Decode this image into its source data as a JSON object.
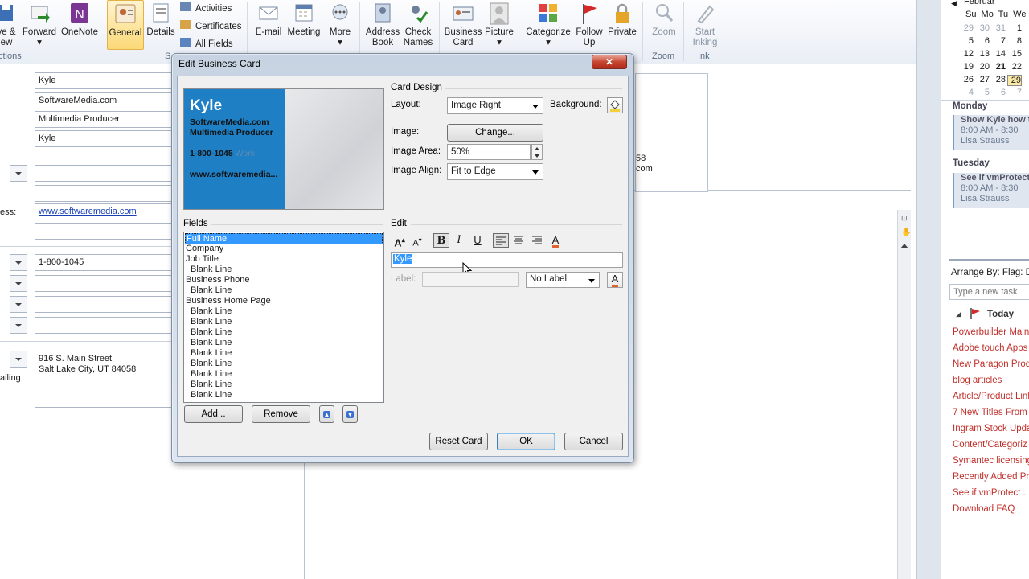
{
  "ribbon": {
    "buttons": [
      {
        "label": "ve &\new",
        "icon": "save-new-icon"
      },
      {
        "label": "Forward",
        "icon": "forward-icon"
      },
      {
        "label": "OneNote",
        "icon": "onenote-icon"
      },
      {
        "label": "General",
        "icon": "general-icon"
      },
      {
        "label": "Details",
        "icon": "details-icon"
      },
      {
        "label": "E-mail",
        "icon": "email-icon"
      },
      {
        "label": "Meeting",
        "icon": "meeting-icon"
      },
      {
        "label": "More",
        "icon": "more-icon"
      },
      {
        "label": "Address Book",
        "icon": "address-book-icon"
      },
      {
        "label": "Check Names",
        "icon": "check-names-icon"
      },
      {
        "label": "Business Card",
        "icon": "business-card-icon"
      },
      {
        "label": "Picture",
        "icon": "picture-icon"
      },
      {
        "label": "Categorize",
        "icon": "categorize-icon"
      },
      {
        "label": "Follow Up",
        "icon": "follow-up-icon"
      },
      {
        "label": "Private",
        "icon": "private-icon"
      },
      {
        "label": "Zoom",
        "icon": "zoom-icon"
      },
      {
        "label": "Start Inking",
        "icon": "inking-icon"
      }
    ],
    "small_items": [
      "Activities",
      "Certificates",
      "All Fields"
    ],
    "groups": [
      "ctions",
      "S",
      "Zoom",
      "Ink"
    ]
  },
  "form": {
    "full_name": "Kyle",
    "company": "SoftwareMedia.com",
    "job_title": "Multimedia Producer",
    "file_as": "Kyle",
    "web_label": "ess:",
    "web_page": "www.softwaremedia.com",
    "phone": "1-800-1045",
    "address": "916 S. Main Street\nSalt Lake City, UT 84058",
    "mailing_label": "ailing",
    "card_partial_1": "58",
    "card_partial_2": "com"
  },
  "todo": {
    "month": "Februar",
    "weekday_headers": [
      "Su",
      "Mo",
      "Tu",
      "We"
    ],
    "weeks": [
      [
        "",
        "29",
        "30",
        "31",
        "1"
      ],
      [
        "",
        "5",
        "6",
        "7",
        "8"
      ],
      [
        "",
        "12",
        "13",
        "14",
        "15"
      ],
      [
        "",
        "19",
        "20",
        "21",
        "22"
      ],
      [
        "",
        "26",
        "27",
        "28",
        "29"
      ],
      [
        "",
        "4",
        "5",
        "6",
        "7"
      ]
    ],
    "monday_label": "Monday",
    "monday_event": {
      "title": "Show Kyle how t",
      "time": "8:00 AM - 8:30",
      "person": "Lisa Strauss"
    },
    "tuesday_label": "Tuesday",
    "tuesday_event": {
      "title": "See if vmProtect",
      "time": "8:00 AM - 8:30",
      "person": "Lisa Strauss"
    },
    "arrange_by": "Arrange By: Flag: D",
    "new_task_placeholder": "Type a new task",
    "today_label": "Today",
    "tasks": [
      "Powerbuilder Main",
      "Adobe touch Apps",
      "New Paragon Prod",
      "blog articles",
      "Article/Product Link",
      "7 New Titles From I",
      "Ingram Stock Upda",
      "Content/Categoriz",
      "Symantec licensing",
      "Recently Added Pro",
      "See if vmProtect ...",
      "Download FAQ"
    ]
  },
  "dialog": {
    "title": "Edit Business Card",
    "preview": {
      "name": "Kyle",
      "company": "SoftwareMedia.com",
      "title": "Multimedia Producer",
      "phone": "1-800-1045",
      "phone_label": "Work",
      "web": "www.softwaremedia..."
    },
    "card_design_label": "Card Design",
    "layout_label": "Layout:",
    "layout_value": "Image Right",
    "background_label": "Background:",
    "image_label": "Image:",
    "change_button": "Change...",
    "image_area_label": "Image Area:",
    "image_area_value": "50%",
    "image_align_label": "Image Align:",
    "image_align_value": "Fit to Edge",
    "fields_label": "Fields",
    "fields": [
      "Full Name",
      "Company",
      "Job Title",
      "Blank Line",
      "Business Phone",
      "Blank Line",
      "Business Home Page",
      "Blank Line",
      "Blank Line",
      "Blank Line",
      "Blank Line",
      "Blank Line",
      "Blank Line",
      "Blank Line",
      "Blank Line",
      "Blank Line"
    ],
    "field_indented": [
      false,
      false,
      false,
      true,
      false,
      true,
      false,
      true,
      true,
      true,
      true,
      true,
      true,
      true,
      true,
      true
    ],
    "selected_field_index": 0,
    "edit_label": "Edit",
    "edit_value": "Kyle",
    "label_label": "Label:",
    "label_option": "No Label",
    "add_button": "Add...",
    "remove_button": "Remove",
    "reset_button": "Reset Card",
    "ok_button": "OK",
    "cancel_button": "Cancel",
    "close_glyph": "✕"
  }
}
